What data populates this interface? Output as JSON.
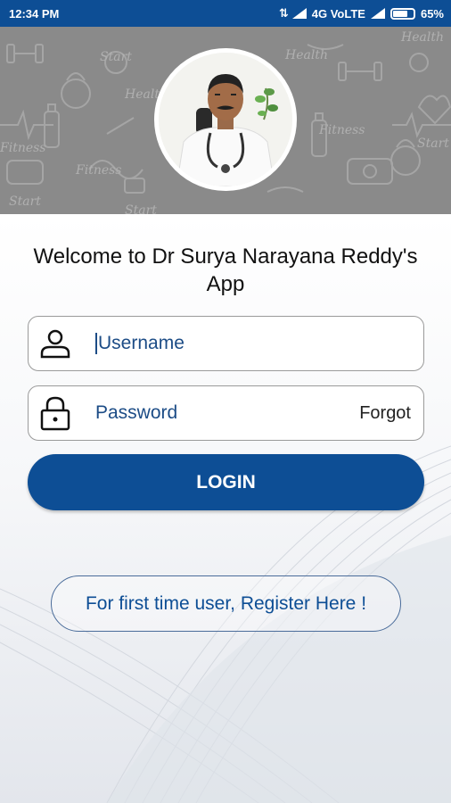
{
  "status_bar": {
    "time": "12:34 PM",
    "network": "4G VoLTE",
    "battery": "65%"
  },
  "colors": {
    "primary": "#0d4e95",
    "header_bg": "#8a8a8a"
  },
  "header": {
    "doodle_words": [
      "Start",
      "Health",
      "Fitness",
      "Health",
      "Fitness",
      "Start",
      "Fitness",
      "Start",
      "Start",
      "Health"
    ],
    "avatar_icon": "doctor-photo"
  },
  "welcome": {
    "line1": "Welcome to Dr Surya Narayana Reddy's",
    "line2": "App"
  },
  "username": {
    "placeholder": "Username",
    "icon": "user-icon"
  },
  "password": {
    "placeholder": "Password",
    "icon": "lock-icon",
    "forgot_label": "Forgot"
  },
  "login_label": "LOGIN",
  "register_label": "For first time user, Register Here !"
}
